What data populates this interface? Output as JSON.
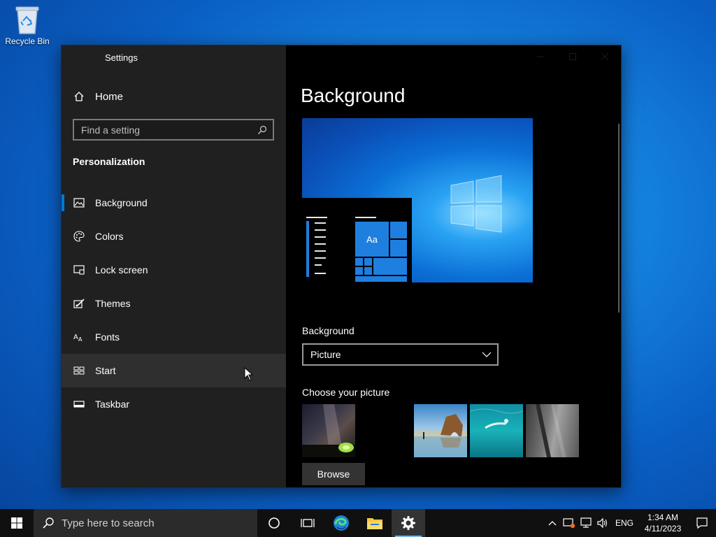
{
  "desktop": {
    "icons": [
      {
        "label": "Recycle Bin",
        "icon": "recycle-bin-icon"
      }
    ]
  },
  "window": {
    "title": "Settings",
    "sidebar": {
      "home_label": "Home",
      "search_placeholder": "Find a setting",
      "section_title": "Personalization",
      "items": [
        {
          "label": "Background",
          "icon": "picture-icon",
          "selected": true
        },
        {
          "label": "Colors",
          "icon": "palette-icon"
        },
        {
          "label": "Lock screen",
          "icon": "lock-screen-icon"
        },
        {
          "label": "Themes",
          "icon": "brush-icon"
        },
        {
          "label": "Fonts",
          "icon": "font-icon"
        },
        {
          "label": "Start",
          "icon": "start-tiles-icon",
          "hovered": true
        },
        {
          "label": "Taskbar",
          "icon": "taskbar-icon"
        }
      ]
    },
    "content": {
      "page_title": "Background",
      "preview_sample_text": "Aa",
      "background_label": "Background",
      "background_value": "Picture",
      "choose_picture_label": "Choose your picture",
      "thumbnails": [
        "night-sky-tent",
        "beach-rock-arch",
        "underwater-swimmer",
        "rock-cliff"
      ],
      "browse_label": "Browse"
    }
  },
  "taskbar": {
    "search_placeholder": "Type here to search",
    "apps": [
      "task-view",
      "edge",
      "file-explorer",
      "settings"
    ],
    "tray": {
      "language": "ENG",
      "time": "1:34 AM",
      "date": "4/11/2023"
    }
  },
  "colors": {
    "accent": "#0078d4",
    "sidebar": "#202020",
    "content": "#000000"
  }
}
